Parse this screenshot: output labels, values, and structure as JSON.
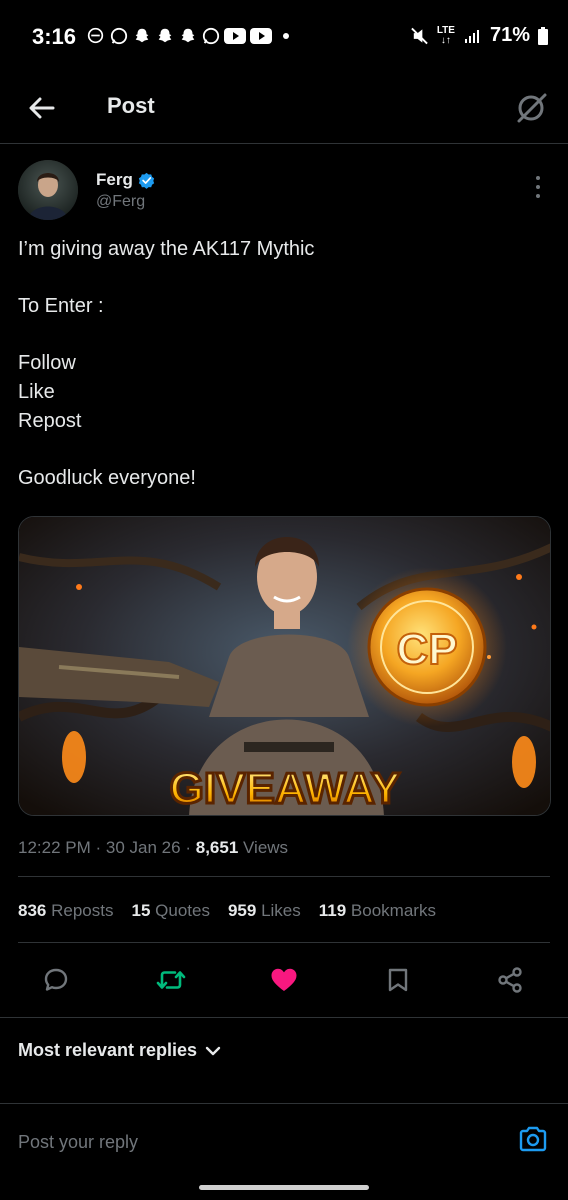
{
  "status_bar": {
    "time": "3:16",
    "battery": "71%",
    "network": "LTE"
  },
  "header": {
    "title": "Post"
  },
  "author": {
    "name": "Ferg",
    "handle": "@Ferg",
    "verified": true
  },
  "post": {
    "lines": [
      "I’m giving away the AK117 Mythic",
      "",
      "To Enter :",
      "",
      "Follow",
      "Like",
      "Repost",
      "",
      "Goodluck everyone!"
    ],
    "image": {
      "caption_text": "GIVEAWAY",
      "coin_text": "CP"
    }
  },
  "meta": {
    "time": "12:22 PM",
    "separator": "·",
    "date": "30 Jan 26",
    "views_count": "8,651",
    "views_label": "Views"
  },
  "stats": {
    "reposts_count": "836",
    "reposts_label": "Reposts",
    "quotes_count": "15",
    "quotes_label": "Quotes",
    "likes_count": "959",
    "likes_label": "Likes",
    "bookmarks_count": "119",
    "bookmarks_label": "Bookmarks"
  },
  "actions": {
    "reply_icon": "speech-bubble-icon",
    "repost_icon": "repost-icon",
    "like_icon": "heart-icon",
    "bookmark_icon": "bookmark-icon",
    "share_icon": "share-icon",
    "repost_color": "#00ba7c",
    "like_color": "#f91880"
  },
  "replies": {
    "sort_label": "Most relevant replies"
  },
  "reply_bar": {
    "placeholder": "Post your reply"
  },
  "colors": {
    "accent": "#1d9bf0",
    "text": "#e7e9ea",
    "muted": "#71767b",
    "border": "#2f3336",
    "background": "#000000"
  }
}
